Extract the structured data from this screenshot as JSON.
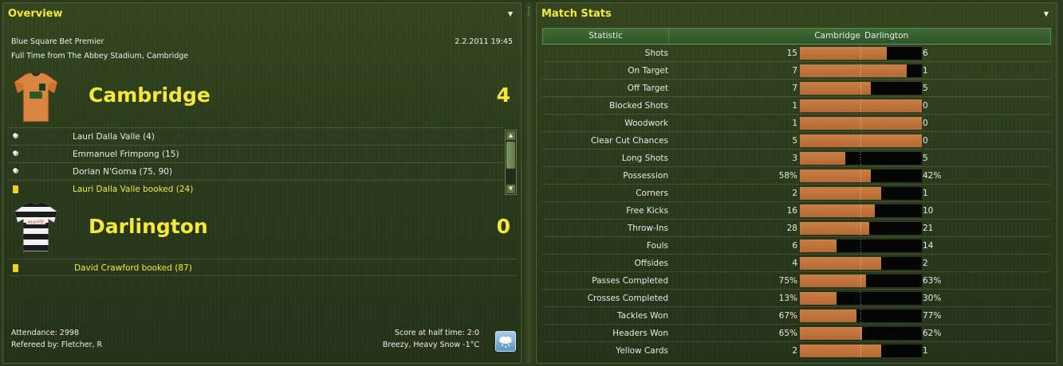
{
  "overview": {
    "title": "Overview",
    "menu_icon": "dropdown-arrow-icon",
    "competition": "Blue Square Bet Premier",
    "datetime": "2.2.2011 19:45",
    "result_line": "Full Time from The Abbey Stadium, Cambridge",
    "home": {
      "name": "Cambridge",
      "score": "4",
      "kit_colors": {
        "body": "#d9843f",
        "sleeve": "#c87432",
        "collar": "#2a2a2a"
      },
      "events": [
        {
          "type": "goal",
          "icon": "football-icon",
          "text": "Lauri Dalla Valle (4)"
        },
        {
          "type": "goal",
          "icon": "football-icon",
          "text": "Emmanuel Frimpong (15)"
        },
        {
          "type": "goal",
          "icon": "football-icon",
          "text": "Dorian N'Goma (75, 90)"
        },
        {
          "type": "booking",
          "icon": "yellow-card-icon",
          "text": "Lauri Dalla Valle booked (24)"
        }
      ]
    },
    "away": {
      "name": "Darlington",
      "score": "0",
      "kit_colors": {
        "stripe_dark": "#1b1b1b",
        "stripe_light": "#f2f2f2"
      },
      "sponsor": "morritt",
      "events": [
        {
          "type": "booking",
          "icon": "yellow-card-icon",
          "text": "David Crawford booked (87)"
        }
      ]
    },
    "attendance": "Attendance: 2998",
    "referee": "Refereed by: Fletcher, R",
    "half_time": "Score at half time: 2:0",
    "weather": "Breezy, Heavy Snow -1°C",
    "weather_icon": "snow-cloud-icon"
  },
  "stats": {
    "title": "Match Stats",
    "menu_icon": "dropdown-arrow-icon",
    "header": {
      "statistic": "Statistic",
      "home": "Cambridge",
      "away": "Darlington"
    },
    "colors": {
      "home_bar": "#c27a42",
      "away_bar": "#050505"
    },
    "rows": [
      {
        "label": "Shots",
        "home": "15",
        "away": "6",
        "home_share": 0.714
      },
      {
        "label": "On Target",
        "home": "7",
        "away": "1",
        "home_share": 0.875
      },
      {
        "label": "Off Target",
        "home": "7",
        "away": "5",
        "home_share": 0.583
      },
      {
        "label": "Blocked Shots",
        "home": "1",
        "away": "0",
        "home_share": 1.0
      },
      {
        "label": "Woodwork",
        "home": "1",
        "away": "0",
        "home_share": 1.0
      },
      {
        "label": "Clear Cut Chances",
        "home": "5",
        "away": "0",
        "home_share": 1.0
      },
      {
        "label": "Long Shots",
        "home": "3",
        "away": "5",
        "home_share": 0.375
      },
      {
        "label": "Possession",
        "home": "58%",
        "away": "42%",
        "home_share": 0.58
      },
      {
        "label": "Corners",
        "home": "2",
        "away": "1",
        "home_share": 0.667
      },
      {
        "label": "Free Kicks",
        "home": "16",
        "away": "10",
        "home_share": 0.615
      },
      {
        "label": "Throw-Ins",
        "home": "28",
        "away": "21",
        "home_share": 0.571
      },
      {
        "label": "Fouls",
        "home": "6",
        "away": "14",
        "home_share": 0.3
      },
      {
        "label": "Offsides",
        "home": "4",
        "away": "2",
        "home_share": 0.667
      },
      {
        "label": "Passes Completed",
        "home": "75%",
        "away": "63%",
        "home_share": 0.543
      },
      {
        "label": "Crosses Completed",
        "home": "13%",
        "away": "30%",
        "home_share": 0.302
      },
      {
        "label": "Tackles Won",
        "home": "67%",
        "away": "77%",
        "home_share": 0.465
      },
      {
        "label": "Headers Won",
        "home": "65%",
        "away": "62%",
        "home_share": 0.512
      },
      {
        "label": "Yellow Cards",
        "home": "2",
        "away": "1",
        "home_share": 0.667
      }
    ]
  }
}
